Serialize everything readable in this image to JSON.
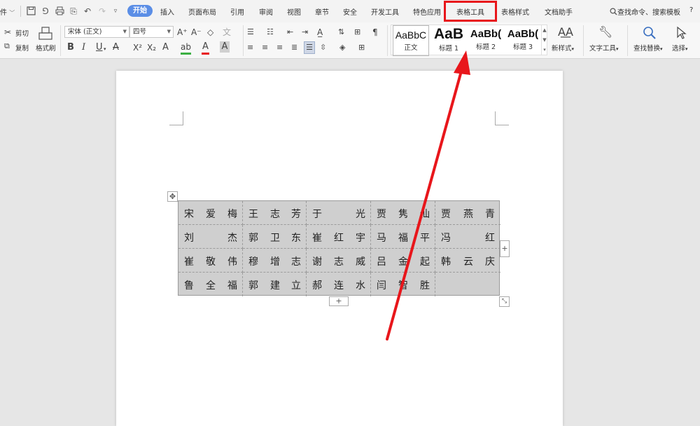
{
  "tabbar": {
    "file_fragment": "件",
    "tabs": [
      "开始",
      "插入",
      "页面布局",
      "引用",
      "审阅",
      "视图",
      "章节",
      "安全",
      "开发工具",
      "特色应用",
      "表格工具",
      "表格样式",
      "文档助手"
    ],
    "search_label": "查找命令、搜索模板",
    "help_label": "?"
  },
  "ribbon": {
    "cut_label": "剪切",
    "copy_label": "复制",
    "format_painter_label": "格式刷",
    "font_name": "宋体 (正文)",
    "font_size": "四号",
    "bold": "B",
    "italic": "I",
    "underline": "U",
    "styles": [
      {
        "preview": "AaBbC",
        "name": "正文"
      },
      {
        "preview": "AaB",
        "name": "标题 1"
      },
      {
        "preview": "AaBb(",
        "name": "标题 2"
      },
      {
        "preview": "AaBb(",
        "name": "标题 3"
      }
    ],
    "new_style_label": "新样式",
    "text_tools_label": "文字工具",
    "find_replace_label": "查找替换",
    "select_label": "选择"
  },
  "table": {
    "rows": [
      [
        [
          "宋",
          "爱",
          "梅"
        ],
        [
          "王",
          "志",
          "芳"
        ],
        [
          "于",
          "",
          "光"
        ],
        [
          "贾",
          "隽",
          "仙"
        ],
        [
          "贾",
          "燕",
          "青"
        ]
      ],
      [
        [
          "刘",
          "",
          "杰"
        ],
        [
          "郭",
          "卫",
          "东"
        ],
        [
          "崔",
          "红",
          "宇"
        ],
        [
          "马",
          "福",
          "平"
        ],
        [
          "冯",
          "",
          "红"
        ]
      ],
      [
        [
          "崔",
          "敬",
          "伟"
        ],
        [
          "穆",
          "增",
          "志"
        ],
        [
          "谢",
          "志",
          "威"
        ],
        [
          "吕",
          "金",
          "起"
        ],
        [
          "韩",
          "云",
          "庆"
        ]
      ],
      [
        [
          "鲁",
          "全",
          "福"
        ],
        [
          "郭",
          "建",
          "立"
        ],
        [
          "郝",
          "连",
          "水"
        ],
        [
          "闫",
          "智",
          "胜"
        ],
        [
          "",
          "",
          ""
        ]
      ]
    ]
  },
  "colors": {
    "highlight": "#e8161b",
    "accent": "#5b8ee6",
    "table_fill": "#cfcfcf"
  }
}
